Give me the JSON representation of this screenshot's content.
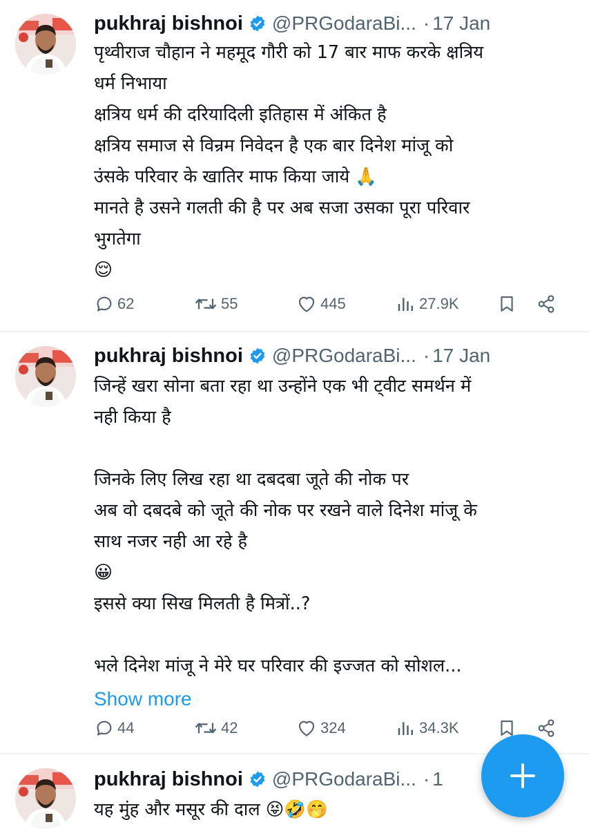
{
  "tweets": [
    {
      "author": {
        "name": "pukhraj bishnoi",
        "handle": "@PRGodaraBi...",
        "dot": "·",
        "date": "17 Jan"
      },
      "lines": [
        "पृथ्वीराज चौहान ने महमूद गौरी को 17 बार माफ करके क्षत्रिय",
        "धर्म निभाया",
        "क्षत्रिय धर्म की दरियादिली इतिहास में अंकित है",
        "क्षत्रिय समाज से विन्रम निवेदन है एक बार दिनेश मांजू को",
        "उंसके परिवार के खातिर माफ किया जाये 🙏",
        "मानते है उसने गलती की है पर अब सजा उसका पूरा परिवार",
        "भुगतेगा",
        "😌"
      ],
      "stats": {
        "replies": "62",
        "reposts": "55",
        "likes": "445",
        "views": "27.9K"
      }
    },
    {
      "author": {
        "name": "pukhraj bishnoi",
        "handle": "@PRGodaraBi...",
        "dot": "·",
        "date": "17 Jan"
      },
      "lines": [
        "जिन्हें खरा सोना बता रहा था उन्होंने एक भी ट्वीट समर्थन में",
        "नही किया है",
        "",
        "जिनके लिए लिख रहा था दबदबा जूते की नोक पर",
        "अब वो दबदबे को जूते की नोक पर रखने वाले दिनेश मांजू के",
        "साथ नजर नही आ रहे है",
        "😀",
        "इससे क्या सिख मिलती है मित्रों..?",
        "",
        "भले दिनेश मांजू ने मेरे घर परिवार की इज्जत को सोशल..."
      ],
      "show_more": "Show more",
      "stats": {
        "replies": "44",
        "reposts": "42",
        "likes": "324",
        "views": "34.3K"
      }
    },
    {
      "author": {
        "name": "pukhraj bishnoi",
        "handle": "@PRGodaraBi...",
        "dot": "·",
        "date": "1"
      },
      "lines": [
        "यह मुंह और मसूर की दाल 😝🤣🤭"
      ]
    }
  ],
  "colors": {
    "text": "#0f1419",
    "secondary": "#536471",
    "accent": "#1d9bf0",
    "divider": "#eff3f4"
  },
  "icons": {
    "reply": "reply-icon",
    "repost": "repost-icon",
    "like": "like-icon",
    "views": "views-icon",
    "bookmark": "bookmark-icon",
    "share": "share-icon",
    "verified": "verified-badge-icon",
    "compose": "plus-icon"
  }
}
